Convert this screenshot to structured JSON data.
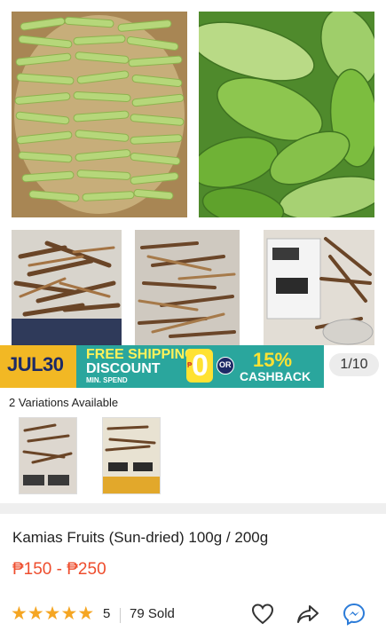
{
  "gallery": {
    "promo": {
      "badge": "JUL30",
      "free_shipping": "FREE SHIPPING",
      "discount": "DISCOUNT",
      "min_spend": "MIN. SPEND",
      "zero": "0",
      "peso_small": "₱",
      "or": "OR",
      "cashback_pct": "15%",
      "cashback": "CASHBACK"
    },
    "counter": "1/10"
  },
  "variations": {
    "title": "2 Variations Available"
  },
  "product": {
    "title": "Kamias Fruits (Sun-dried) 100g / 200g",
    "price": "₱150 - ₱250",
    "rating": "5",
    "sold": "79 Sold"
  },
  "icons": [
    "star-icon",
    "heart-icon",
    "share-icon",
    "messenger-icon"
  ]
}
